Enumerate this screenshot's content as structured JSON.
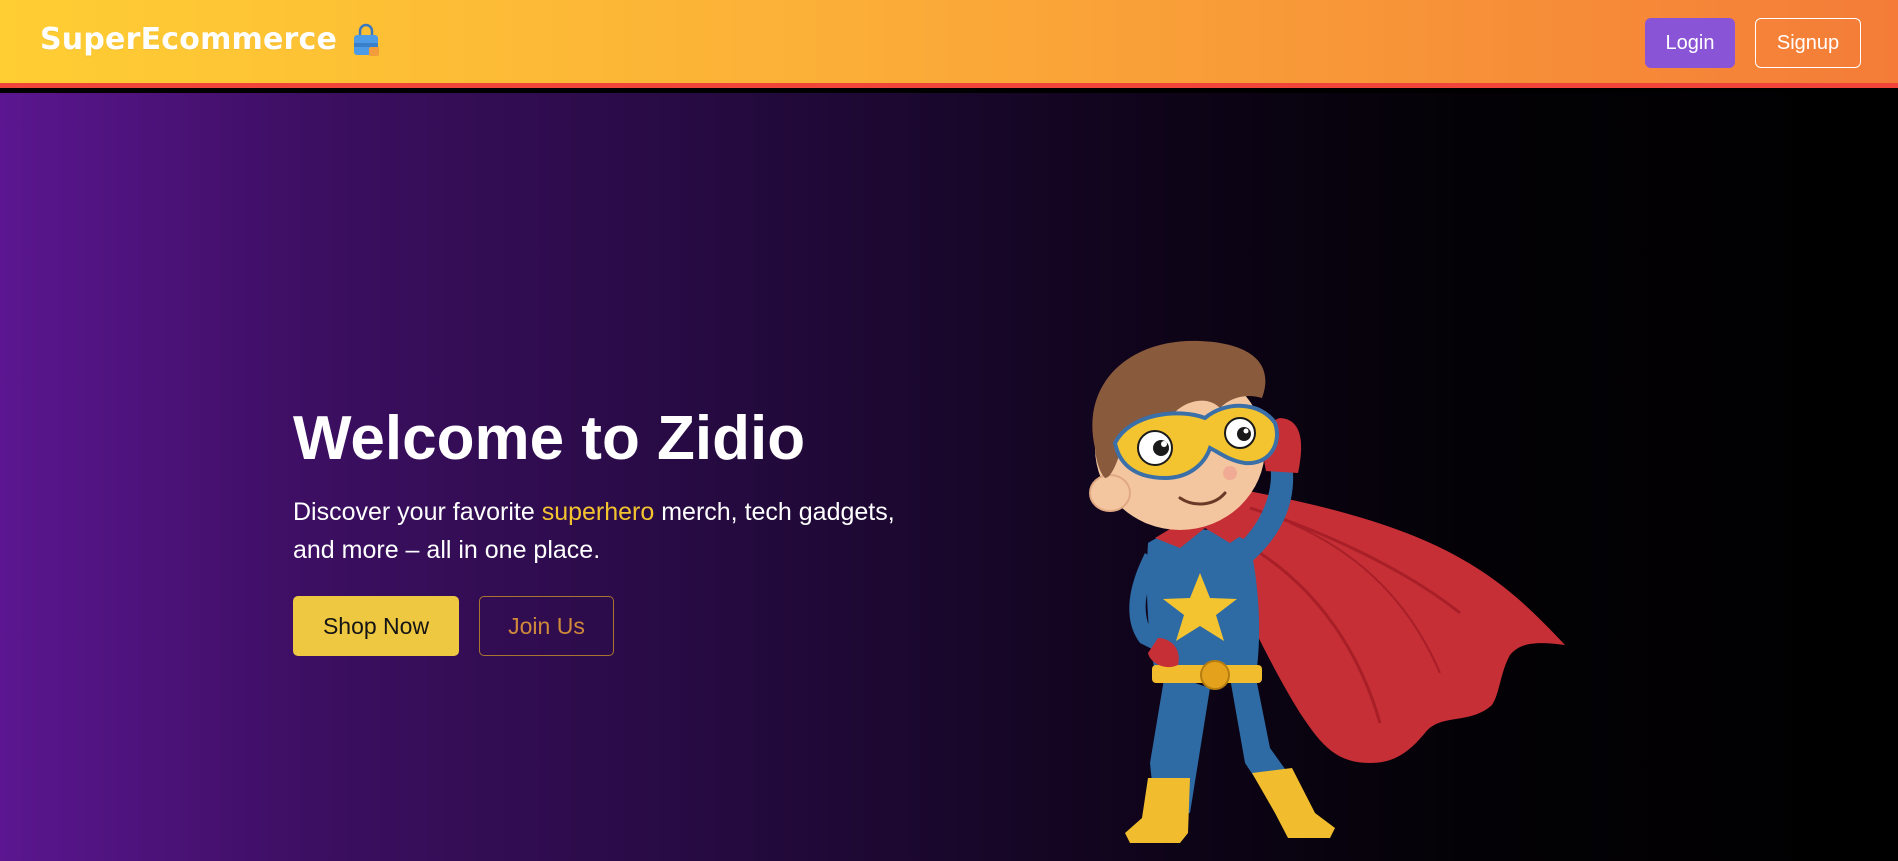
{
  "navbar": {
    "brand": "SuperEcommerce",
    "brand_icon": "shopping-bag-icon",
    "login_label": "Login",
    "signup_label": "Signup",
    "colors": {
      "gradient_start": "#ffce33",
      "gradient_end": "#f47c38",
      "bottom_border": "#f0433a",
      "login_bg": "#8a54d6"
    }
  },
  "hero": {
    "title": "Welcome to Zidio",
    "subtitle_before": "Discover your favorite ",
    "subtitle_highlight": "superhero",
    "subtitle_after": " merch, tech gadgets, and more – all in one place.",
    "primary_cta": "Shop Now",
    "secondary_cta": "Join Us",
    "illustration": "superhero-kid-illustration",
    "colors": {
      "bg_start": "#5b1690",
      "bg_end": "#000000",
      "highlight": "#f4c430",
      "primary_cta_bg": "#efc842",
      "secondary_cta_text": "#d08a3a"
    }
  }
}
